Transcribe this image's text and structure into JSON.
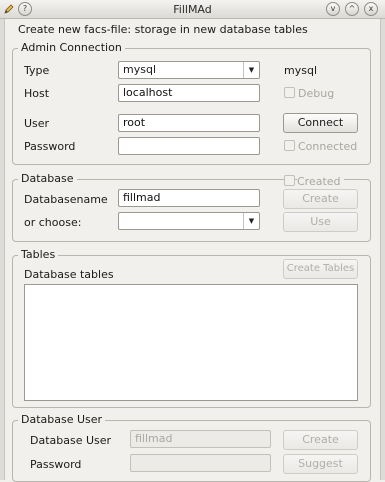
{
  "window": {
    "title": "FillMAd",
    "app_icon": "pencil-icon",
    "controls": [
      "help-icon",
      "minimize-icon",
      "maximize-icon",
      "close-icon"
    ],
    "controls_glyphs": {
      "help": "?",
      "minimize": "v",
      "maximize": "^",
      "close": "x"
    }
  },
  "header_text": "Create new facs-file: storage in new database tables",
  "admin": {
    "legend": "Admin Connection",
    "type_label": "Type",
    "type_value": "mysql",
    "type_display": "mysql",
    "host_label": "Host",
    "host_value": "localhost",
    "debug_label": "Debug",
    "user_label": "User",
    "user_value": "root",
    "connect_label": "Connect",
    "password_label": "Password",
    "password_value": "",
    "connected_label": "Connected"
  },
  "database": {
    "legend": "Database",
    "created_label": "Created",
    "dbname_label": "Databasename",
    "dbname_value": "fillmad",
    "create_label": "Create",
    "choose_label": "or choose:",
    "choose_value": "",
    "use_label": "Use"
  },
  "tables": {
    "legend": "Tables",
    "db_tables_label": "Database tables",
    "create_tables_label": "Create Tables",
    "items": []
  },
  "db_user": {
    "legend": "Database User",
    "user_label": "Database User",
    "user_value": "fillmad",
    "create_label": "Create",
    "password_label": "Password",
    "password_value": "",
    "suggest_label": "Suggest"
  },
  "colors": {
    "window_bg": "#f2f0ec",
    "border": "#b9b6b0",
    "disabled_text": "#a9a7a2"
  }
}
